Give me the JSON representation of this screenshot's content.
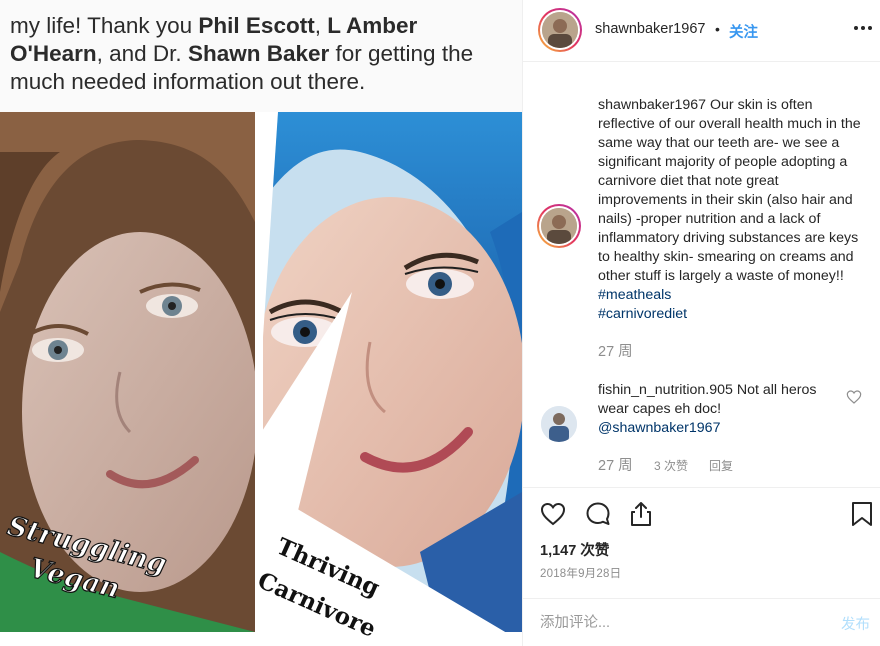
{
  "post_image": {
    "text_before": "my life! Thank you ",
    "name1": "Phil Escott",
    "sep1": ", ",
    "name2": "L Amber O'Hearn",
    "sep2": ", and Dr. ",
    "name3": "Shawn Baker",
    "text_after": " for getting the much needed information out there.",
    "label_left_line1": "Struggling",
    "label_left_line2": "Vegan",
    "label_right_line1": "Thriving",
    "label_right_line2": "Carnivore"
  },
  "header": {
    "username": "shawnbaker1967",
    "dot": "•",
    "follow_label": "关注",
    "more_icon": "more-horizontal-icon"
  },
  "caption": {
    "username": "shawnbaker1967",
    "text": " Our skin is often reflective of our overall health much in the same way that our teeth are- we see a significant majority of people adopting a carnivore diet that note great improvements in their skin (also hair and nails) -proper nutrition and a lack of inflammatory driving substances are keys to healthy skin- smearing on creams and other stuff is largely a waste of money!! ",
    "hashtag1": "#meatheals",
    "hashtag2": "#carnivorediet",
    "time": "27 周"
  },
  "comment": {
    "username": "fishin_n_nutrition.905",
    "text": " Not all heros wear capes eh doc! ",
    "mention": "@shawnbaker1967",
    "time": "27 周",
    "likes": "3 次赞",
    "reply": "回复"
  },
  "actions": {
    "likes": "1,147 次赞",
    "date": "2018年9月28日",
    "placeholder": "添加评论...",
    "post_label": "发布"
  },
  "colors": {
    "link": "#003569",
    "follow": "#3897f0",
    "muted": "#8e8e8e",
    "post_disabled": "#b2dffc"
  }
}
